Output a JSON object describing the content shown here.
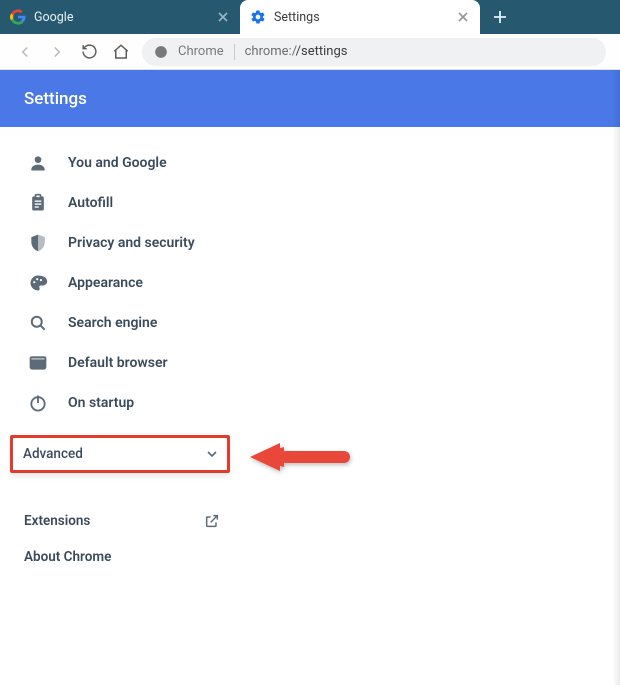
{
  "tabs": {
    "inactive": {
      "title": "Google"
    },
    "active": {
      "title": "Settings"
    }
  },
  "omnibox": {
    "site": "Chrome",
    "url_prefix": "chrome:/",
    "url_suffix": "/settings"
  },
  "header": {
    "title": "Settings"
  },
  "sidebar": {
    "items": [
      {
        "label": "You and Google"
      },
      {
        "label": "Autofill"
      },
      {
        "label": "Privacy and security"
      },
      {
        "label": "Appearance"
      },
      {
        "label": "Search engine"
      },
      {
        "label": "Default browser"
      },
      {
        "label": "On startup"
      }
    ]
  },
  "advanced": {
    "label": "Advanced"
  },
  "secondary": {
    "extensions": "Extensions",
    "about": "About Chrome"
  }
}
